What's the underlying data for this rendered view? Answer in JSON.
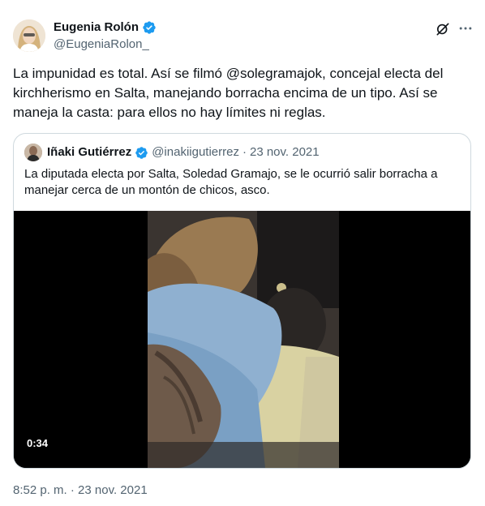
{
  "tweet": {
    "author": {
      "display_name": "Eugenia Rolón",
      "handle": "@EugeniaRolon_",
      "verified_icon": "verified-badge-icon",
      "verified_color": "#1d9bf0"
    },
    "text": "La impunidad es total. Así se filmó @solegramajok, concejal electa del kirchherismo en Salta, manejando borracha encima de un tipo. Así se maneja la casta: para ellos no hay límites ni reglas.",
    "timestamp": "8:52 p. m. · 23 nov. 2021",
    "actions": {
      "grok_icon": "grok-icon",
      "more_icon": "more-options-icon"
    }
  },
  "quoted_tweet": {
    "author": {
      "display_name": "Iñaki Gutiérrez",
      "handle": "@inakiigutierrez",
      "verified_icon": "verified-badge-icon"
    },
    "separator": "·",
    "date": "23 nov. 2021",
    "text": "La diputada electa por Salta, Soledad Gramajo, se le ocurrió salir borracha a manejar cerca de un montón de chicos, asco.",
    "video": {
      "duration": "0:34"
    }
  }
}
